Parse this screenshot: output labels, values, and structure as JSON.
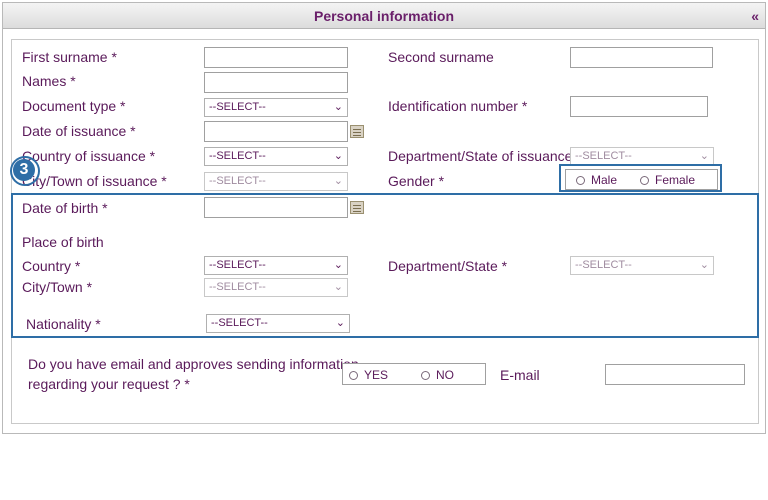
{
  "header": {
    "title": "Personal information",
    "collapse_icon": "«"
  },
  "fields": {
    "first_surname": "First surname *",
    "second_surname": "Second surname",
    "names": "Names *",
    "document_type": "Document type *",
    "identification_number": "Identification number *",
    "date_of_issuance": "Date of issuance *",
    "country_of_issuance": "Country of issuance *",
    "department_state_of_issuance": "Department/State of issuance *",
    "city_town_of_issuance": "City/Town of issuance *",
    "gender": "Gender *",
    "date_of_birth": "Date of birth *",
    "place_of_birth": "Place of birth",
    "country": "Country *",
    "department_state": "Department/State *",
    "city_town": "City/Town *",
    "nationality": "Nationality *",
    "email_question_line1": "Do you have email and approves sending information",
    "email_question_line2": "regarding your request ? *",
    "email": "E-mail"
  },
  "select_default": "--SELECT--",
  "gender_options": {
    "male": "Male",
    "female": "Female"
  },
  "email_options": {
    "yes": "YES",
    "no": "NO"
  },
  "callout": {
    "number": "3",
    "color": "#2e6ea6"
  },
  "colors": {
    "label": "#5a1a5a",
    "highlight": "#2e6ea6"
  }
}
